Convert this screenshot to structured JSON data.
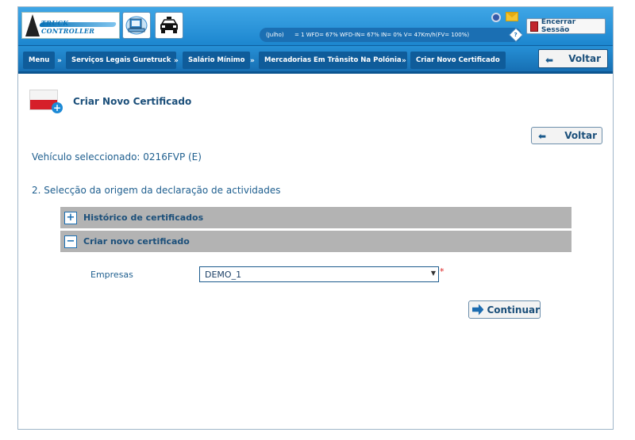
{
  "header": {
    "logo_text_a": "TRUCK",
    "logo_text_b": "CONTROLLER",
    "status_text": "(Julho)       = 1  WFD= 67%  WFD-IN= 67%  IN= 0%  V= 47Km/h(FV= 100%)",
    "help_glyph": "?",
    "logout_label": "Encerrar Sessão"
  },
  "breadcrumb": {
    "items": [
      {
        "label": "Menu"
      },
      {
        "label": "Serviços Legais Guretruck"
      },
      {
        "label": "Salário Mínimo"
      },
      {
        "label": "Mercadorias Em Trânsito Na Polónia"
      },
      {
        "label": "Criar Novo Certificado"
      }
    ],
    "separator": "»",
    "back_label": "Voltar"
  },
  "main": {
    "title": "Criar Novo Certificado",
    "back_label": "Voltar",
    "vehicle_text": "Vehículo seleccionado: 0216FVP (E)",
    "section_text": "2. Selecção da origem da declaração de actividades",
    "accordions": [
      {
        "label": "Histórico de certificados",
        "toggle": "+"
      },
      {
        "label": "Criar novo certificado",
        "toggle": "−"
      }
    ],
    "empresas_label": "Empresas",
    "empresas_value": "DEMO_1",
    "required_mark": "*",
    "continue_label": "Continuar"
  },
  "icons": {
    "back": "back-arrow-icon",
    "continue": "right-arrow-icon",
    "logout": "door-exit-icon",
    "info": "info-icon",
    "mail": "mail-icon",
    "computer": "computer-icon",
    "police-car": "police-car-icon"
  },
  "colors": {
    "header_blue": "#1c86cf",
    "crumb_dark": "#0f5c9a",
    "text_blue": "#1b4f7a",
    "accordion_gray": "#b3b3b3",
    "flag_red": "#d61f2a"
  }
}
